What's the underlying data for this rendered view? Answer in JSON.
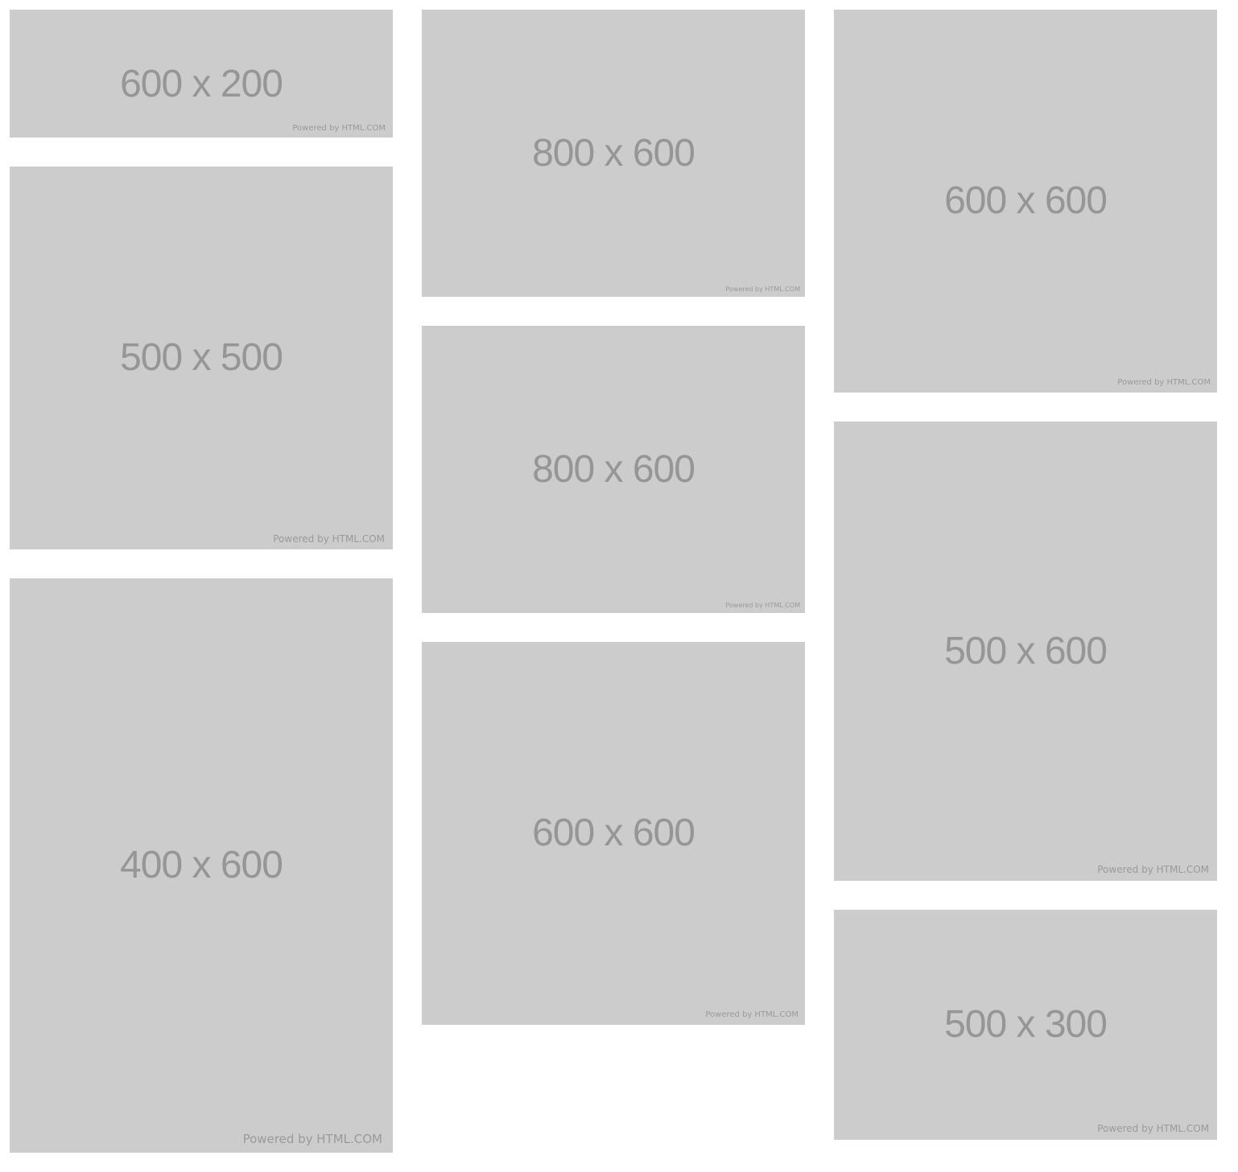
{
  "brand_credit": "Powered by HTML.COM",
  "colors": {
    "background": "#ffffff",
    "tile": "#cccccc",
    "label": "#969696",
    "credit": "#9a9a9a"
  },
  "tiles": [
    {
      "label": "600 x 200",
      "credit": "Powered by HTML.COM"
    },
    {
      "label": "500 x 500",
      "credit": "Powered by HTML.COM"
    },
    {
      "label": "400 x 600",
      "credit": "Powered by HTML.COM"
    },
    {
      "label": "800 x 600",
      "credit": "Powered by HTML.COM"
    },
    {
      "label": "800 x 600",
      "credit": "Powered by HTML.COM"
    },
    {
      "label": "600 x 600",
      "credit": "Powered by HTML.COM"
    },
    {
      "label": "600 x 600",
      "credit": "Powered by HTML.COM"
    },
    {
      "label": "500 x 600",
      "credit": "Powered by HTML.COM"
    },
    {
      "label": "500 x 300",
      "credit": "Powered by HTML.COM"
    }
  ]
}
